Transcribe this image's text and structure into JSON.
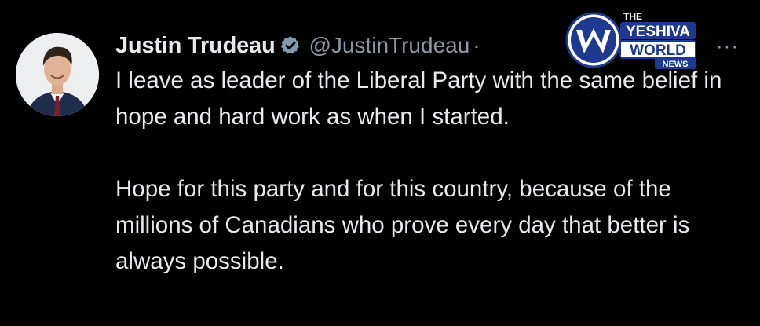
{
  "tweet": {
    "display_name": "Justin Trudeau",
    "handle": "@JustinTrudeau",
    "separator": "·",
    "more_label": "···",
    "paragraphs": [
      "I leave as leader of the Liberal Party with the same belief in hope and hard work as when I started.",
      "Hope for this party and for this country, because of the millions of Canadians who prove every day that better is always possible."
    ]
  },
  "icons": {
    "verified": "verified-badge-icon",
    "more": "more-options-icon"
  },
  "watermark": {
    "line1": "THE",
    "line2": "YESHIVA",
    "line3": "WORLD",
    "line4": "NEWS"
  },
  "colors": {
    "background": "#000000",
    "text": "#e7e9ea",
    "secondary_text": "#8b98a5",
    "verified_badge": "#829aab",
    "watermark_blue": "#1d3a8f"
  }
}
